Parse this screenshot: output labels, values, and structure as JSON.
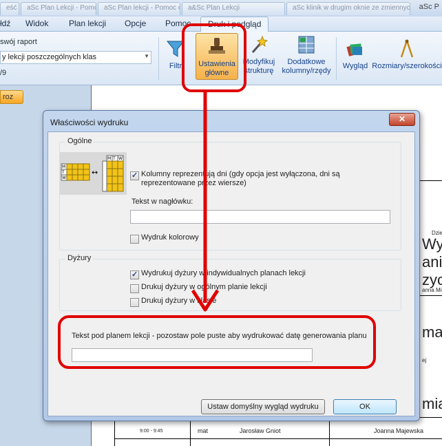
{
  "titlebar": {
    "doc_tabs": [
      "eść",
      "aSc Plan Lekcji - Pomoc online",
      "aSc Plan lekcji - Pomoc online",
      "a&Sc Plan Lekcji",
      "aSc klinik w drugim oknie ze zmiennych"
    ],
    "app_title": "aSc P"
  },
  "menu": {
    "items": [
      "łdź",
      "Widok",
      "Plan lekcji",
      "Opcje",
      "Pomoc",
      "Druk i podgląd"
    ]
  },
  "ribbon": {
    "own_report": "swój raport",
    "select_value": "y lekcji poszczególnych klas",
    "page_counter": "/9",
    "filter_label": "Filtr",
    "main_settings_line1": "Ustawienia",
    "main_settings_line2": "główne",
    "modify_line1": "Modyfikuj",
    "modify_line2": "strukturę",
    "extra_line1": "Dodatkowe",
    "extra_line2": "kolumny/rzędy",
    "look_label": "Wygląd",
    "sizes_label": "Rozmiary/szerokości"
  },
  "doc_tab": "roz",
  "preview": {
    "texts": [
      "Dzie",
      "Wych",
      "anie",
      "zycz",
      "anna Mich",
      "ma",
      "ej",
      "mia",
      "9:00 - 9:45",
      "mat",
      "Jarosław Gniot",
      "Joanna Majewska"
    ]
  },
  "dialog": {
    "title": "Właściwości wydruku",
    "close_symbol": "✕",
    "general": {
      "label": "Ogólne",
      "days_in_columns": "Kolumny reprezentują dni (gdy opcja jest wyłączona, dni są",
      "days_in_columns_2": "reprezentowane przez wiersze)",
      "header_text_label": "Tekst w nagłówku:",
      "header_text_value": "",
      "color_print": "Wydruk kolorowy",
      "illustration_letters": [
        "M",
        "T",
        "W"
      ],
      "arrow": "↔"
    },
    "duty": {
      "label": "Dyżury",
      "individual": "Wydrukuj dyżury w indywidualnych planach lekcji",
      "general": "Drukuj dyżury w ogólnym planie lekcji",
      "class": "Drukuj dyżury w klasie"
    },
    "footer_text_label": "Tekst pod planem lekcji - pozostaw pole puste aby wydrukować datę generowania planu",
    "footer_text_value": "",
    "default_button": "Ustaw domyślny wygląd wydruku",
    "ok_button": "OK"
  },
  "colors": {
    "annotation": "#e00000",
    "ribbon_active": "#f6b14b",
    "window_frame": "#b2c8e6"
  }
}
